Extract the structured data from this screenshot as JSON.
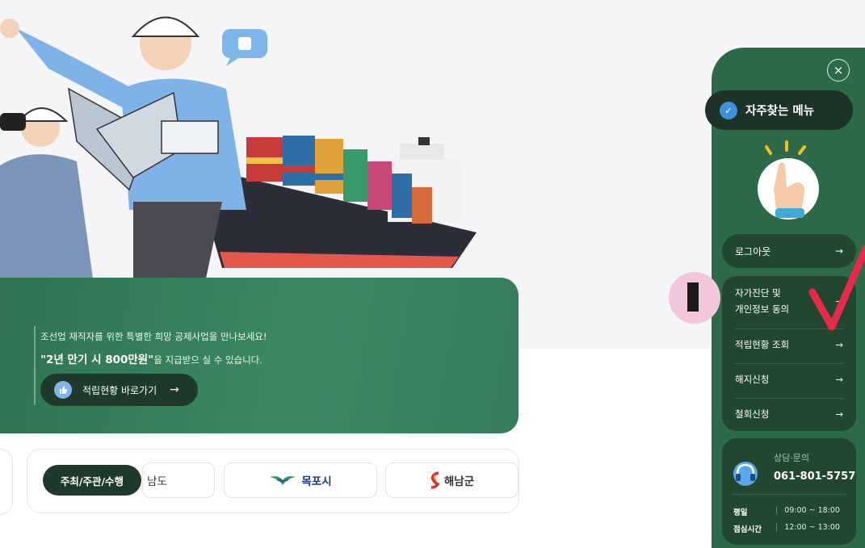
{
  "banner": {
    "line1": "조선업 재직자를 위한 특별한 희망 공제사업을 만나보세요!",
    "line2_bold": "\"2년 만기 시 800만원\"",
    "line2_rest": "을 지급받으 실 수 있습니다.",
    "cta_label": "적립현황 바로가기",
    "cta_arrow": "→"
  },
  "sponsors": {
    "tag": "주최/주관/수행",
    "logos": [
      "남도",
      "목포시",
      "해남군"
    ]
  },
  "quick_menu": {
    "close_symbol": "×",
    "title": "자주찾는 메뉴",
    "logout_label": "로그아웃",
    "items": [
      {
        "label_line1": "자가진단 및",
        "label_line2": "개인정보 동의"
      },
      {
        "label": "적립현황 조회"
      },
      {
        "label": "해지신청"
      },
      {
        "label": "철회신청"
      }
    ],
    "arrow": "→",
    "contact": {
      "title": "상담·문의",
      "phone": "061-801-5757",
      "hours": [
        {
          "key": "평일",
          "value": "09:00 ~ 18:00"
        },
        {
          "key": "점심시간",
          "value": "12:00 ~ 13:00"
        }
      ]
    }
  },
  "overlay": {
    "marker": "I"
  },
  "colors": {
    "banner_green": "#3b8a62",
    "panel_green": "#2d6b48",
    "dark_green": "#1d3328",
    "check_red": "#e8294a"
  }
}
